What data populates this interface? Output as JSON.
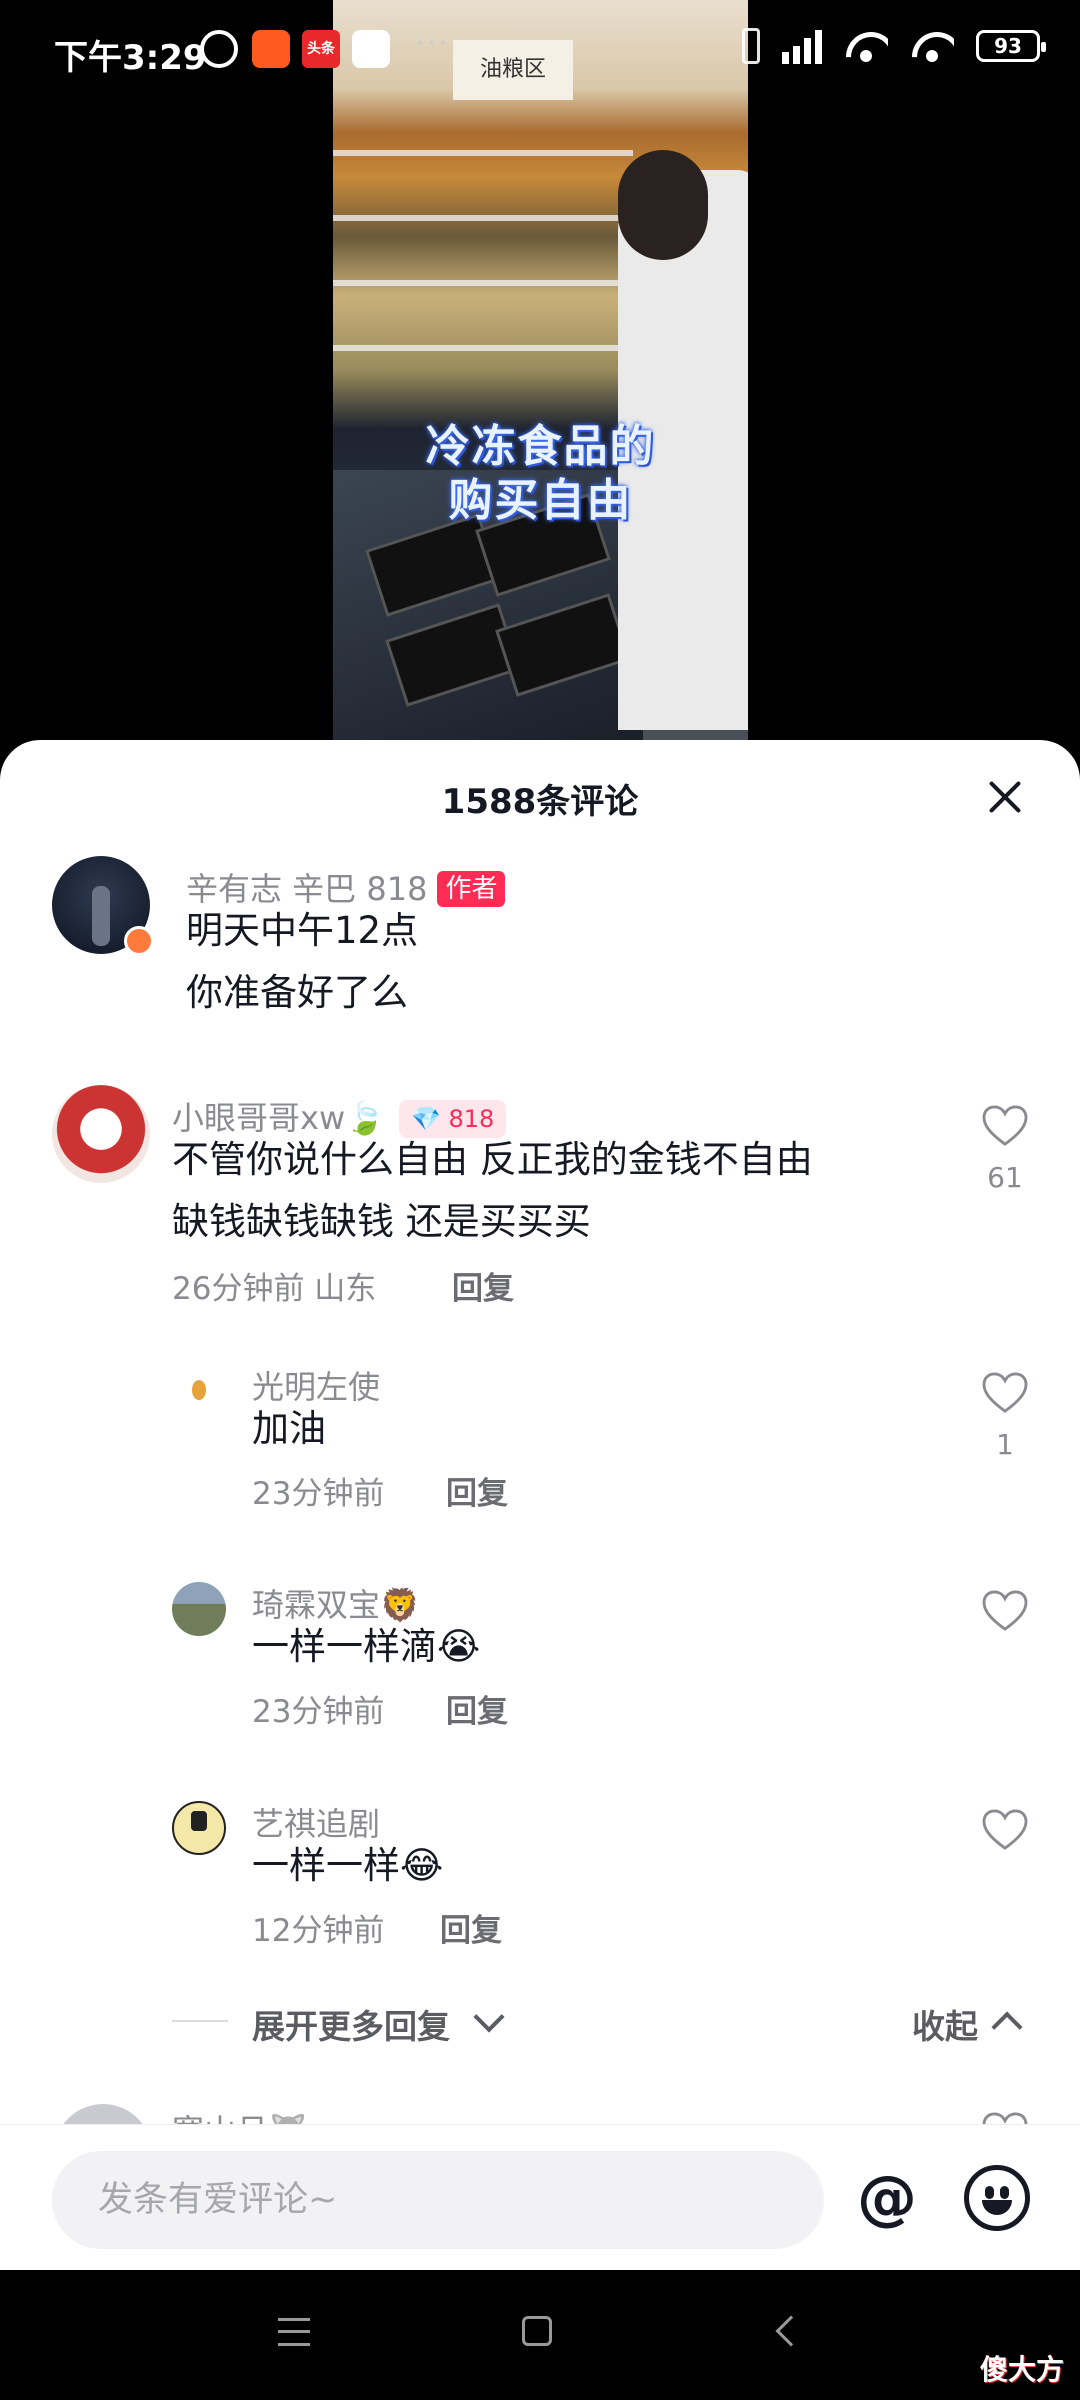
{
  "status_bar": {
    "time": "下午3:29",
    "battery": "93",
    "app_badge": "头条"
  },
  "video": {
    "caption_line1": "冷冻食品的",
    "caption_line2": "购买自由",
    "sign": "油粮区"
  },
  "sheet": {
    "title": "1588条评论"
  },
  "comments": [
    {
      "username": "辛有志 辛巴 818",
      "badge": "作者",
      "lines": [
        "明天中午12点",
        "你准备好了么"
      ]
    },
    {
      "username": "小眼哥哥xw🍃",
      "badge": "💎 818",
      "lines": [
        "不管你说什么自由 反正我的金钱不自由",
        "缺钱缺钱缺钱 还是买买买"
      ],
      "time": "26分钟前 山东",
      "reply": "回复",
      "likes": "61"
    }
  ],
  "replies": [
    {
      "username": "光明左使",
      "text": "加油",
      "time": "23分钟前",
      "reply": "回复",
      "likes": "1"
    },
    {
      "username": "琦霖双宝🦁",
      "text": "一样一样滴😭",
      "time": "23分钟前",
      "reply": "回复",
      "likes": ""
    },
    {
      "username": "艺祺追剧",
      "text": "一样一样😂",
      "time": "12分钟前",
      "reply": "回复",
      "likes": ""
    }
  ],
  "expand": {
    "more_label": "展开更多回复",
    "collapse_label": "收起"
  },
  "next_comment": {
    "username": "寒山月🐺"
  },
  "input": {
    "placeholder": "发条有爱评论~"
  },
  "watermark": "傻大方",
  "colors": {
    "accent": "#fe2c55",
    "text": "#161823",
    "muted": "#8a8b91"
  }
}
